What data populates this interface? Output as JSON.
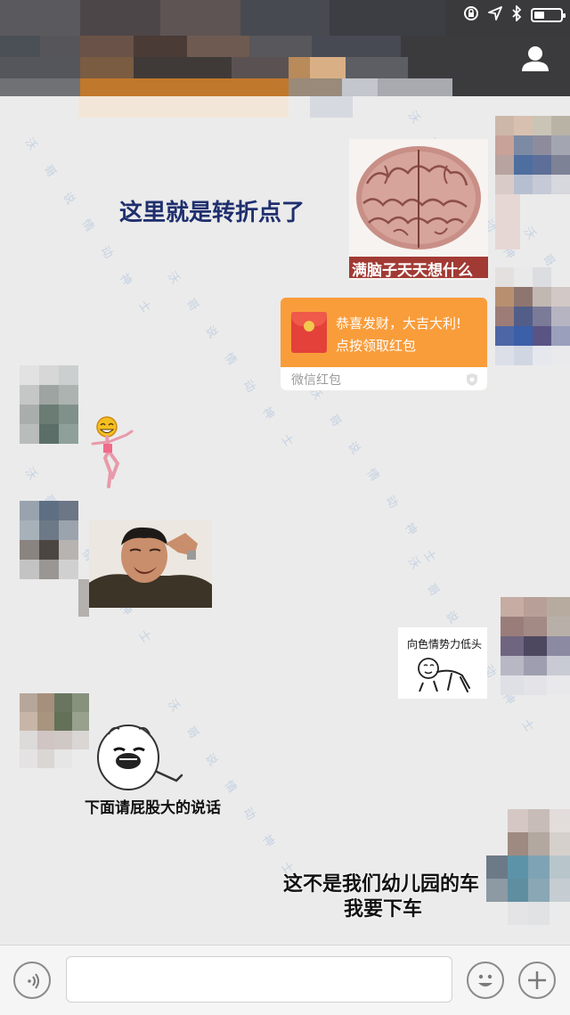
{
  "header": {
    "status": {
      "lock_icon": "orientation-lock-icon",
      "location_icon": "location-arrow-icon",
      "bluetooth_icon": "bluetooth-icon",
      "battery_level": 0.4
    },
    "profile_icon": "person-icon"
  },
  "messages": {
    "brain_caption": "满脑子天天想什么",
    "turning_point": "这里就是转折点了",
    "red_packet": {
      "title": "恭喜发财，大吉大利!",
      "subtitle": "点按领取红包",
      "footer": "微信红包"
    },
    "bow_sticker_text": "向色情势力低头",
    "butt_sticker_text": "下面请屁股大的说话",
    "not_my_car_line1": "这不是我们幼儿园的车",
    "not_my_car_line2": "我要下车"
  },
  "input_bar": {
    "voice_icon": "voice-icon",
    "emoji_icon": "emoji-icon",
    "add_icon": "plus-icon",
    "input_value": ""
  },
  "colors": {
    "background": "#ebebeb",
    "red_packet": "#f99d3b",
    "turning_text": "#1f2f6e"
  }
}
